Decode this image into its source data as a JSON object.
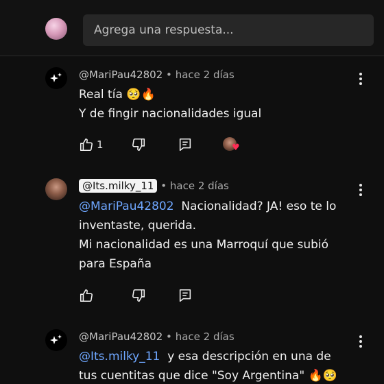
{
  "composer": {
    "placeholder": "Agrega una respuesta..."
  },
  "comments": [
    {
      "username": "@MariPau42802",
      "separator": "•",
      "time": "hace 2 días",
      "lines": [
        "Real tía",
        "Y de fingir nacionalidades igual"
      ],
      "emojis": [
        "🥺",
        "🔥"
      ],
      "like_count": "1"
    },
    {
      "username": "@Its.milky_11",
      "separator": "•",
      "time": "hace 2 días",
      "mention": "@MariPau42802",
      "lines": [
        "Nacionalidad? JA! eso te lo",
        "inventaste, querida.",
        "Mi nacionalidad es una Marroquí que subió",
        "para España"
      ]
    },
    {
      "username": "@MariPau42802",
      "separator": "•",
      "time": "hace 2 días",
      "mention": "@Its.milky_11",
      "lines": [
        "y esa descripción en una de",
        "tus cuentitas que dice \"Soy Argentina\""
      ],
      "emojis": [
        "🔥",
        "🥺"
      ]
    }
  ],
  "icons": {
    "like": "thumbs-up-icon",
    "dislike": "thumbs-down-icon",
    "reply": "reply-icon",
    "more": "kebab-menu-icon",
    "creator_heart": "heart-icon"
  },
  "colors": {
    "background": "#0f0f0f",
    "mention": "#6fa7ff",
    "heart": "#ff2d55"
  }
}
